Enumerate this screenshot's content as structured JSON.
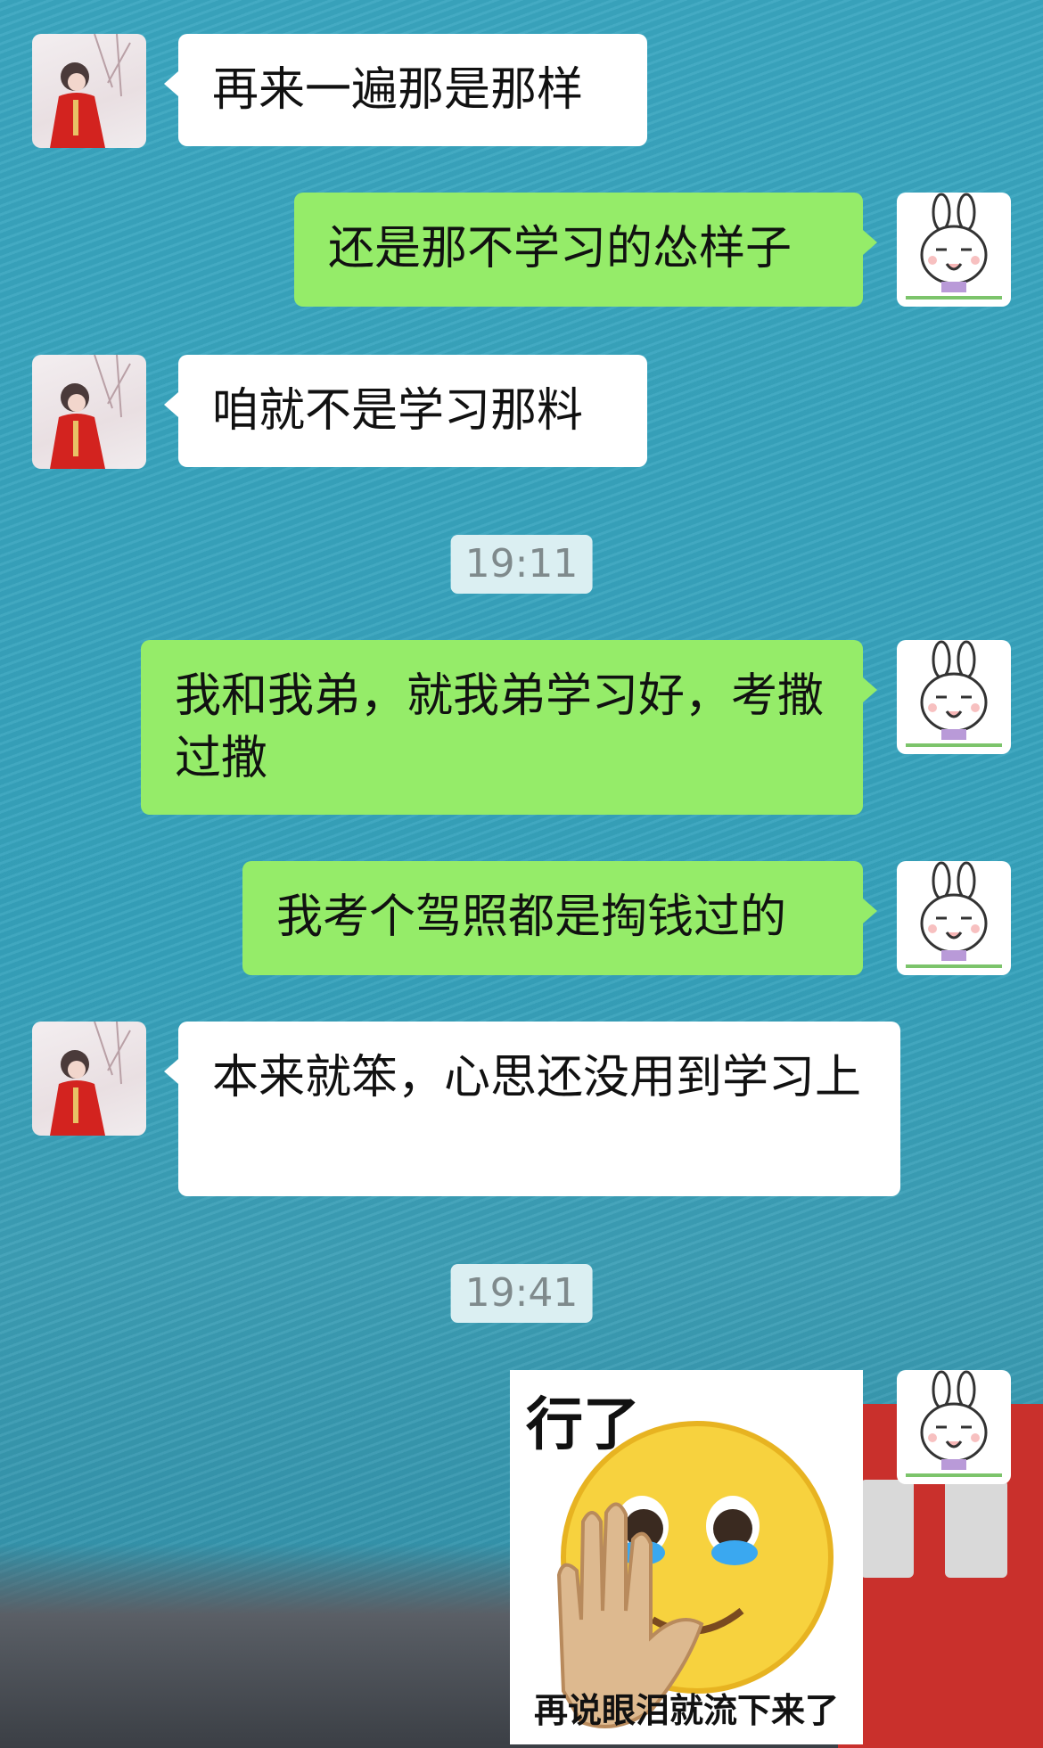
{
  "messages": [
    {
      "sender": "contact",
      "text": "再来一遍那是那样"
    },
    {
      "sender": "me",
      "text": "还是那不学习的怂样子"
    },
    {
      "sender": "contact",
      "text": "咱就不是学习那料"
    },
    {
      "sender": "me",
      "text": "我和我弟，就我弟学习好，考撒过撒"
    },
    {
      "sender": "me",
      "text": "我考个驾照都是掏钱过的"
    },
    {
      "sender": "contact",
      "text": "本来就笨，心思还没用到学习上"
    }
  ],
  "timestamps": [
    "19:11",
    "19:41"
  ],
  "sticker": {
    "top_text": "行了",
    "bottom_text": "再说眼泪就流下来了",
    "icon": "crying-face-hand-icon"
  },
  "avatars": {
    "contact": "girl-red-dress-avatar",
    "me": "bunny-avatar"
  },
  "colors": {
    "outgoing_bubble": "#95ec69",
    "incoming_bubble": "#ffffff",
    "background": "#3aa6c0"
  }
}
